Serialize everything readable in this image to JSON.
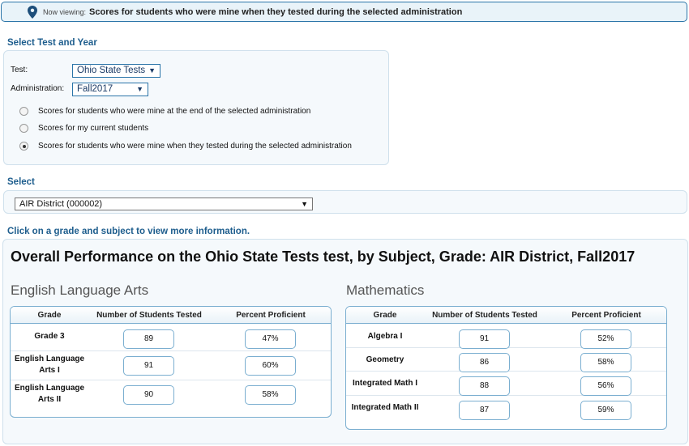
{
  "banner": {
    "label": "Now viewing:",
    "value": "Scores for students who were mine when they tested during the selected administration"
  },
  "select_test_year": {
    "title": "Select Test and Year",
    "test_label": "Test:",
    "test_value": "Ohio State Tests",
    "admin_label": "Administration:",
    "admin_value": "Fall2017",
    "radios": [
      {
        "label": "Scores for students who were mine at the end of the selected administration",
        "checked": false
      },
      {
        "label": "Scores for my current students",
        "checked": false
      },
      {
        "label": "Scores for students who were mine when they tested during the selected administration",
        "checked": true
      }
    ]
  },
  "select_org": {
    "title": "Select",
    "value": "AIR District (000002)"
  },
  "instruction": "Click on a grade and subject to view more information.",
  "performance": {
    "title": "Overall Performance on the Ohio State Tests test, by Subject, Grade: AIR District, Fall2017",
    "columns": [
      "Grade",
      "Number of Students Tested",
      "Percent Proficient"
    ],
    "subjects": [
      {
        "name": "English Language Arts",
        "rows": [
          {
            "grade": "Grade 3",
            "tested": "89",
            "proficient": "47%"
          },
          {
            "grade": "English Language Arts I",
            "tested": "91",
            "proficient": "60%"
          },
          {
            "grade": "English Language Arts II",
            "tested": "90",
            "proficient": "58%"
          }
        ]
      },
      {
        "name": "Mathematics",
        "rows": [
          {
            "grade": "Algebra I",
            "tested": "91",
            "proficient": "52%"
          },
          {
            "grade": "Geometry",
            "tested": "86",
            "proficient": "58%"
          },
          {
            "grade": "Integrated Math I",
            "tested": "88",
            "proficient": "56%"
          },
          {
            "grade": "Integrated Math II",
            "tested": "87",
            "proficient": "59%"
          }
        ]
      }
    ]
  },
  "icons": {
    "banner": "map-pin-icon",
    "dropdown": "caret-down-icon"
  },
  "colors": {
    "accent": "#1d5d8d",
    "border": "#2a74a8",
    "panel_bg": "#f5f9fc"
  }
}
